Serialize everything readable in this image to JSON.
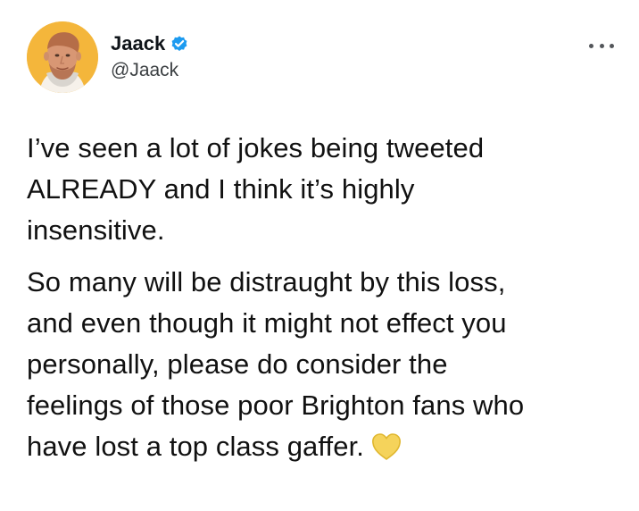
{
  "tweet": {
    "author": {
      "display_name": "Jaack",
      "handle": "@Jaack",
      "verified": true,
      "avatar_icon": "profile-photo"
    },
    "menu_icon": "more-options-icon",
    "paragraphs": [
      "I’ve seen a lot of jokes being tweeted\nALREADY and I think it’s highly\ninsensitive.",
      "So many will be distraught by this loss,\nand even though it might not effect you\npersonally, please do consider the\nfeelings of those poor Brighton fans who\nhave lost a top class gaffer."
    ],
    "emoji": "yellow-heart",
    "colors": {
      "verified_badge": "#1d9bf0",
      "heart": "#f5d35b",
      "avatar_background": "#f4b63b"
    }
  }
}
